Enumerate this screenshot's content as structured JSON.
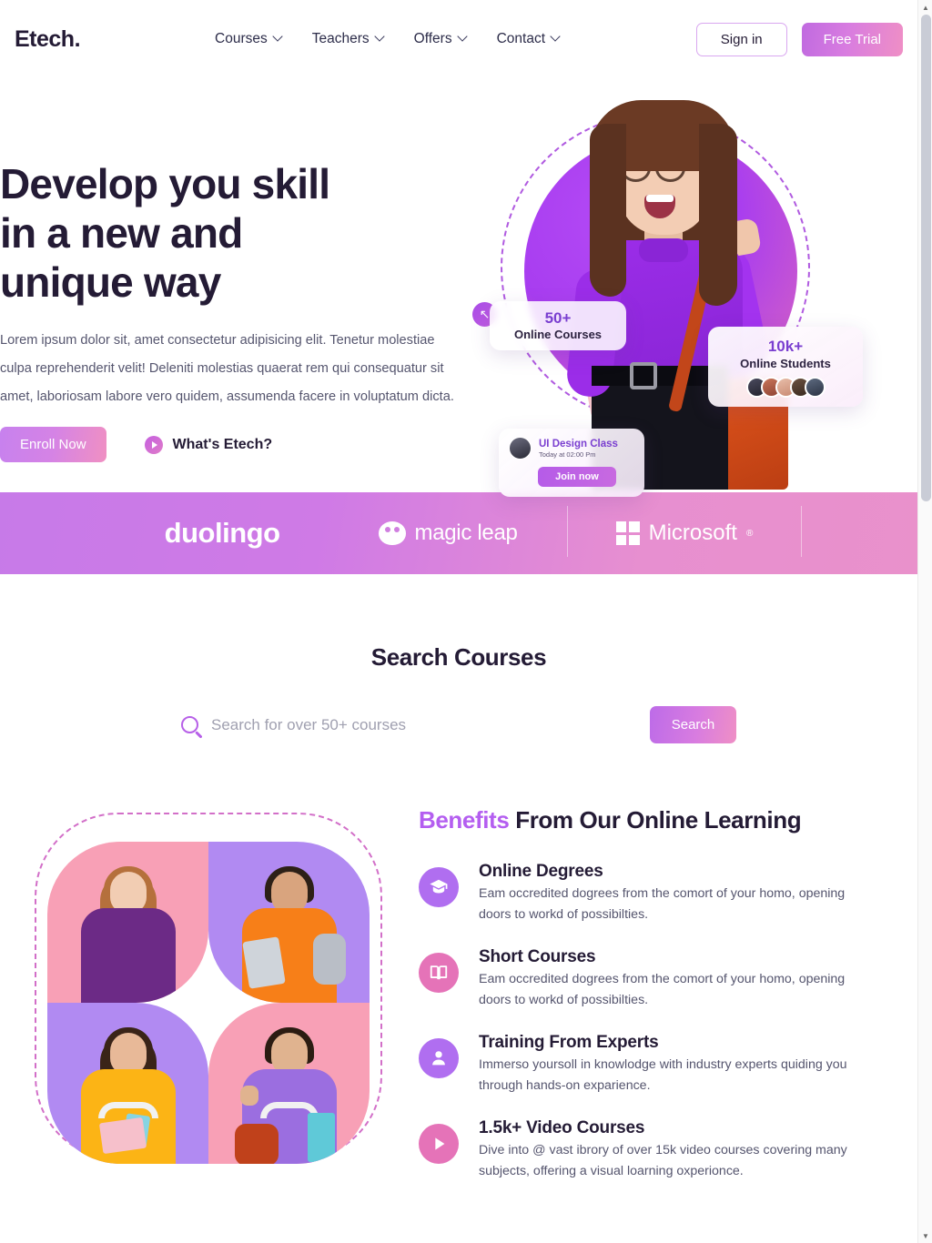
{
  "brand": {
    "logo": "Etech."
  },
  "nav": {
    "items": [
      {
        "label": "Courses",
        "icon": "chevron-down-icon"
      },
      {
        "label": "Teachers",
        "icon": "chevron-down-icon"
      },
      {
        "label": "Offers",
        "icon": "chevron-down-icon"
      },
      {
        "label": "Contact",
        "icon": "chevron-down-icon"
      }
    ],
    "sign_in": "Sign in",
    "free_trial": "Free Trial"
  },
  "hero": {
    "title_line1": "Develop you skill",
    "title_line2": "in a new and",
    "title_line3": "unique way",
    "paragraph": "Lorem ipsum dolor sit, amet consectetur adipisicing elit. Tenetur molestiae culpa reprehenderit velit! Deleniti molestias quaerat rem qui consequatur sit amet, laboriosam labore vero quidem, assumenda facere in voluptatum dicta.",
    "enroll_label": "Enroll Now",
    "video_label": "What's Etech?",
    "cards": {
      "courses": {
        "value": "50+",
        "label": "Online Courses",
        "badge_icon": "arrow-up-left-icon"
      },
      "students": {
        "value": "10k+",
        "label": "Online Students"
      },
      "class": {
        "title": "UI Design Class",
        "time": "Today at 02:00 Pm",
        "cta": "Join now"
      }
    }
  },
  "partners": [
    {
      "name": "duolingo",
      "icon": "duolingo-wordmark"
    },
    {
      "name": "magic leap",
      "icon": "magic-leap-mark"
    },
    {
      "name": "Microsoft",
      "icon": "microsoft-grid-icon",
      "tm": "®"
    }
  ],
  "search": {
    "title": "Search Courses",
    "placeholder": "Search for over 50+ courses",
    "value": "",
    "button": "Search",
    "icon": "search-icon"
  },
  "benefits": {
    "heading_highlight": "Benefits",
    "heading_rest": " From Our Online Learning",
    "items": [
      {
        "icon": "graduation-cap-icon",
        "color": "#b06ef0",
        "title": "Online Degrees",
        "desc": "Eam occredited dogrees from the comort of your homo, opening doors to workd of possibilties."
      },
      {
        "icon": "open-book-icon",
        "color": "#e573b8",
        "title": "Short Courses",
        "desc": "Eam occredited dogrees from the comort of your homo, opening doors to workd of possibilties."
      },
      {
        "icon": "user-icon",
        "color": "#b06ef0",
        "title": "Training From Experts",
        "desc": "Immerso yoursoll in knowlodge with industry experts quiding you through hands-on exparience."
      },
      {
        "icon": "play-icon",
        "color": "#e573b8",
        "title": "1.5k+ Video Courses",
        "desc": "Dive into @ vast ibrory of over 15k video courses covering many subjects, offering a visual loarning oxperionce."
      }
    ]
  },
  "scrollbar": {
    "up": "▲",
    "down": "▼"
  },
  "colors": {
    "accent_purple": "#b45ef0",
    "accent_pink": "#e573b8",
    "ink": "#241b35",
    "muted": "#55556e"
  }
}
